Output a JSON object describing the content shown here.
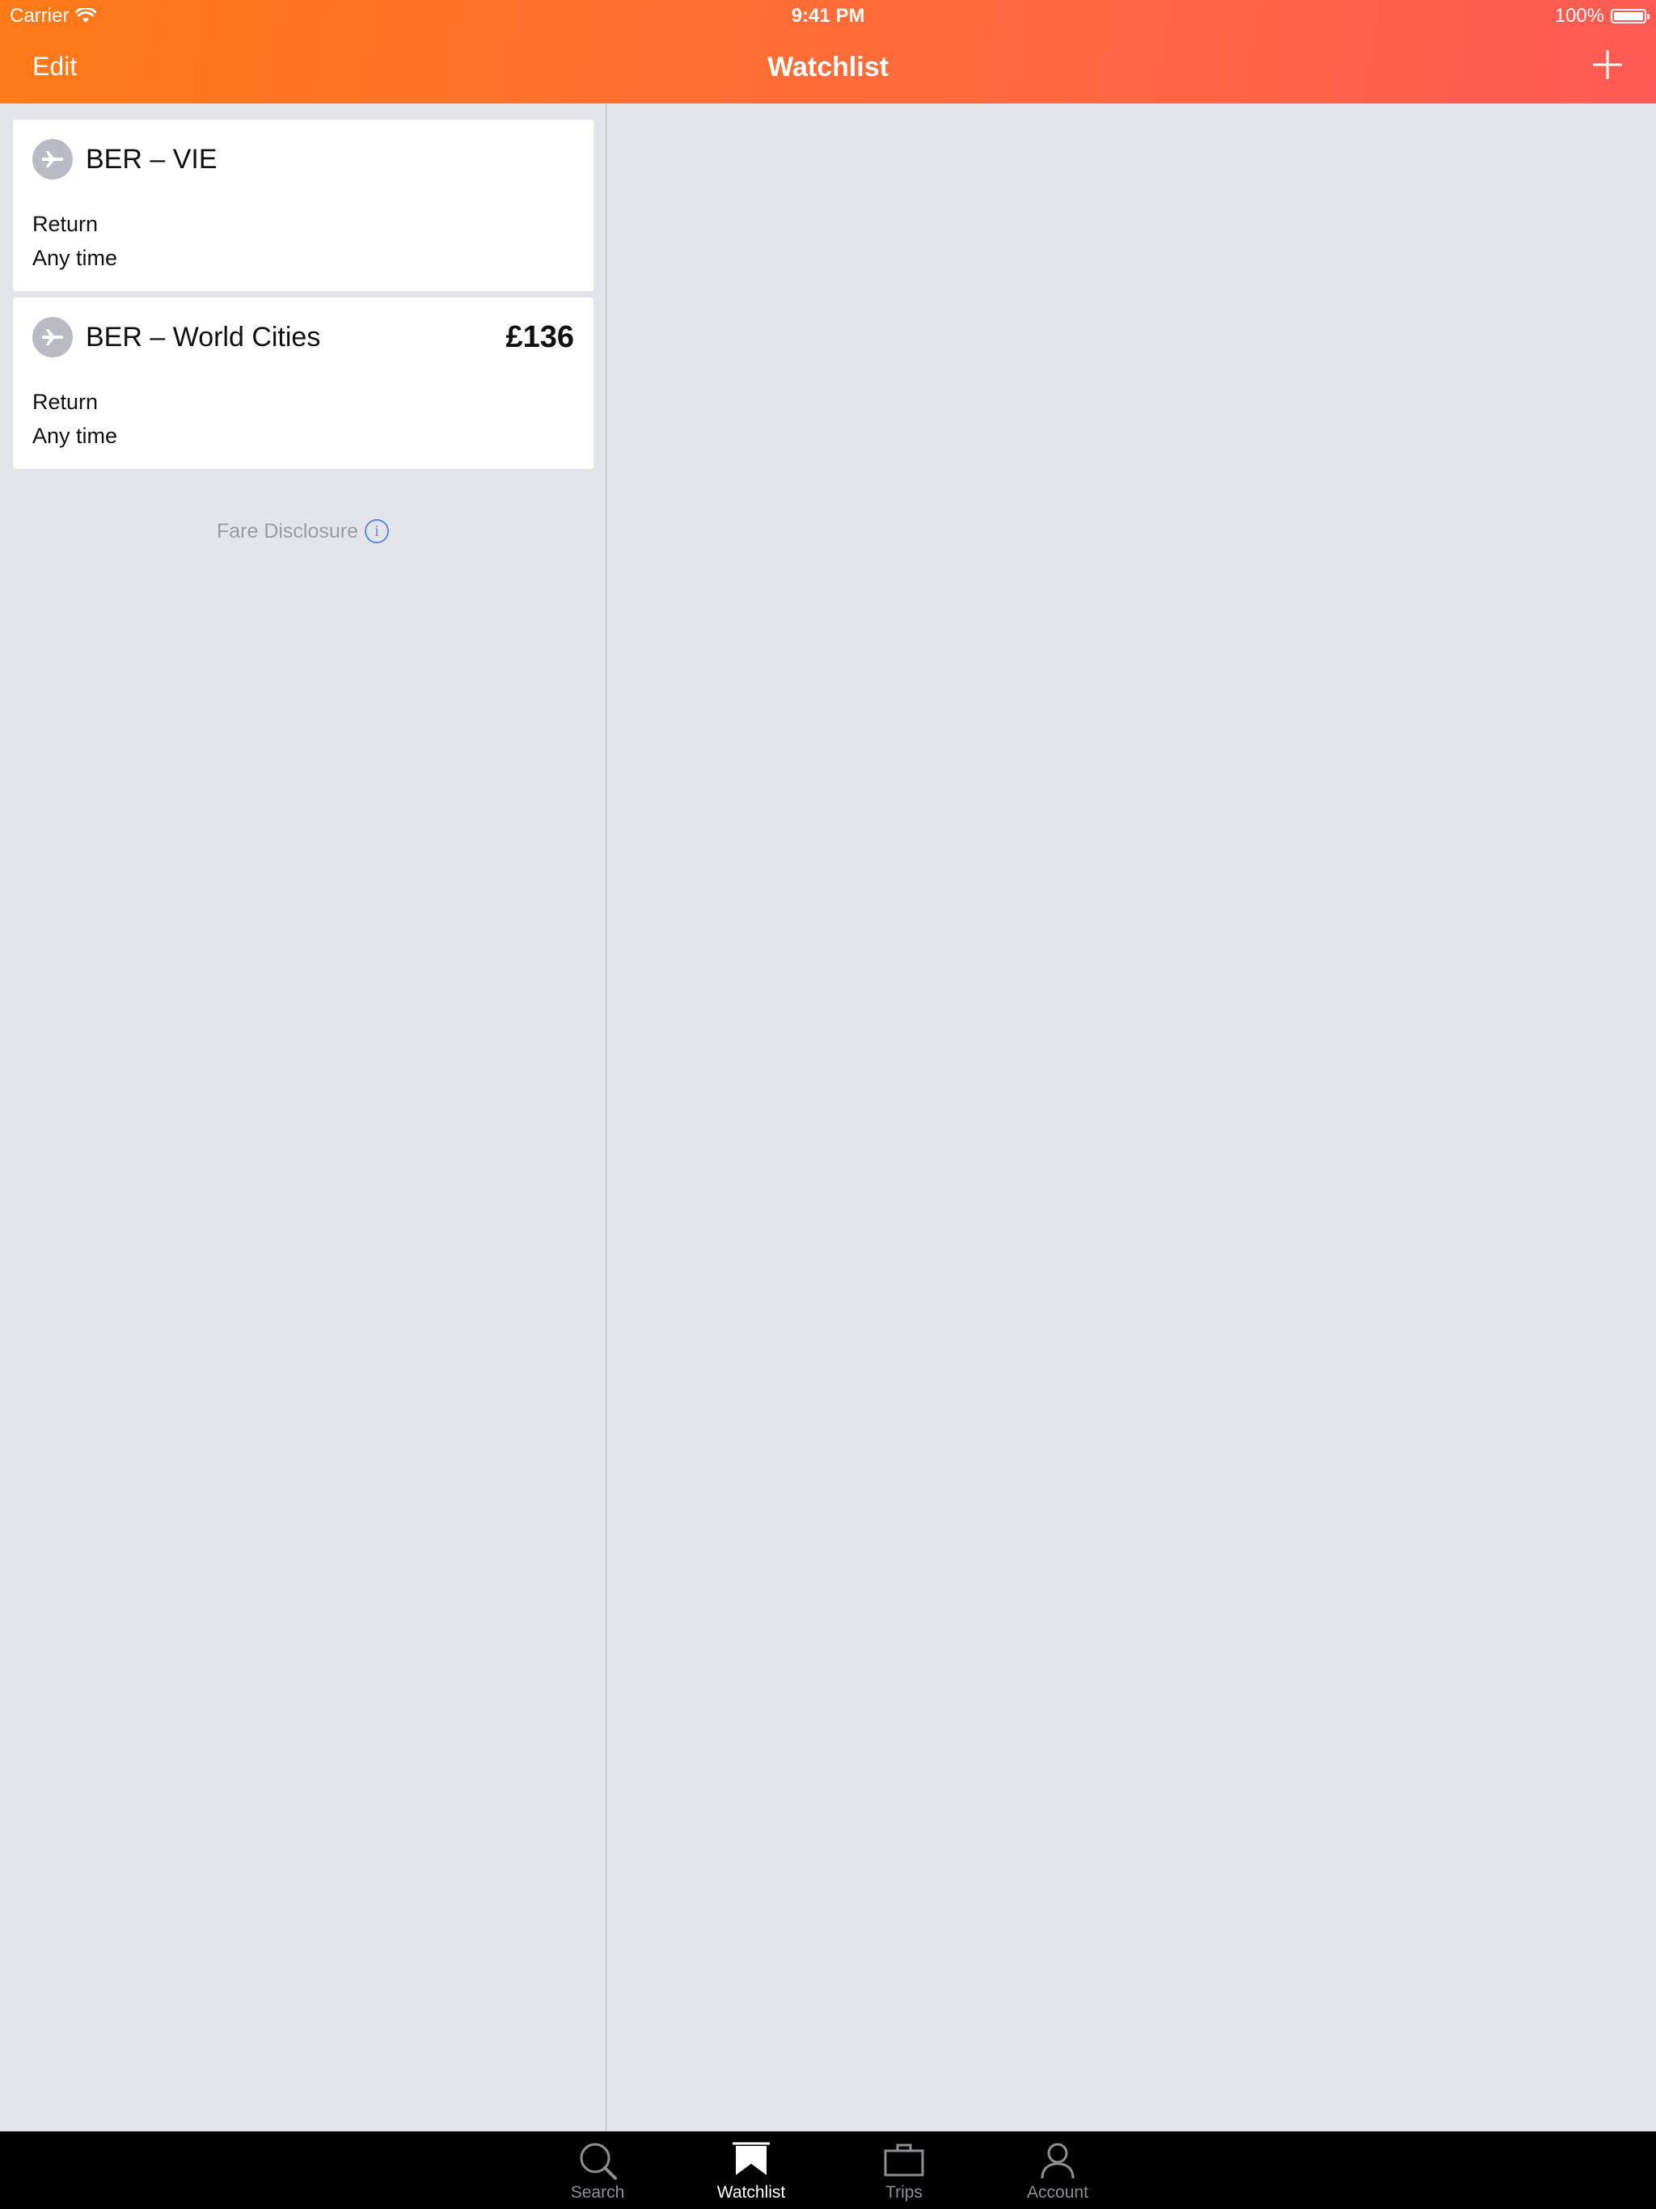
{
  "status_bar": {
    "carrier": "Carrier",
    "time": "9:41 PM",
    "battery": "100%"
  },
  "nav": {
    "edit_label": "Edit",
    "title": "Watchlist",
    "add_icon": "plus-icon"
  },
  "watchlist": [
    {
      "icon": "plane-icon",
      "route": "BER – VIE",
      "price": "",
      "trip_type": "Return",
      "time": "Any time"
    },
    {
      "icon": "plane-icon",
      "route": "BER – World Cities",
      "price": "£136",
      "trip_type": "Return",
      "time": "Any time"
    }
  ],
  "fare_disclosure": {
    "label": "Fare Disclosure",
    "icon": "info-icon"
  },
  "tabs": [
    {
      "label": "Search",
      "icon": "search-icon",
      "active": false
    },
    {
      "label": "Watchlist",
      "icon": "bookmark-icon",
      "active": true
    },
    {
      "label": "Trips",
      "icon": "briefcase-icon",
      "active": false
    },
    {
      "label": "Account",
      "icon": "person-icon",
      "active": false
    }
  ],
  "colors": {
    "header_gradient_start": "#ff7a17",
    "header_gradient_end": "#ff5a55",
    "background": "#e4e5ea",
    "tab_bar": "#000000",
    "info_blue": "#5b8fe0"
  }
}
